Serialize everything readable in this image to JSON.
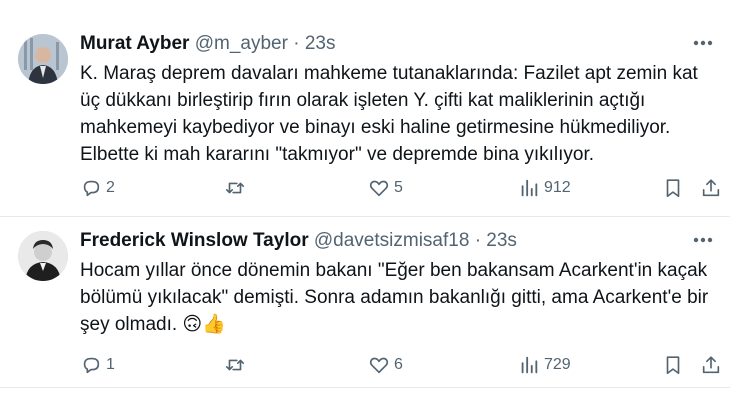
{
  "tweets": [
    {
      "name": "Murat Ayber",
      "handle": "@m_ayber",
      "dot": "·",
      "time": "23s",
      "text": "K. Maraş deprem davaları mahkeme tutanaklarında: Fazilet apt zemin kat üç dükkanı birleştirip fırın olarak işleten Y. çifti kat maliklerinin açtığı mahkemeyi kaybediyor ve binayı eski haline getirmesine hükmediliyor. Elbette ki mah kararını \"takmıyor\" ve depremde bina yıkılıyor.",
      "replies": "2",
      "retweets": "",
      "likes": "5",
      "views": "912"
    },
    {
      "name": "Frederick Winslow Taylor",
      "handle": "@davetsizmisaf18",
      "dot": "·",
      "time": "23s",
      "text": "Hocam yıllar önce dönemin bakanı \"Eğer ben bakansam Acarkent'in kaçak bölümü yıkılacak\" demişti. Sonra adamın bakanlığı gitti, ama Acarkent'e bir şey olmadı. 🙃👍",
      "replies": "1",
      "retweets": "",
      "likes": "6",
      "views": "729"
    }
  ],
  "colors": {
    "text": "#0f1419",
    "muted": "#536471",
    "divider": "#e7e9ea"
  },
  "icons": [
    "reply-icon",
    "retweet-icon",
    "like-icon",
    "views-icon",
    "bookmark-icon",
    "share-icon",
    "more-icon"
  ]
}
